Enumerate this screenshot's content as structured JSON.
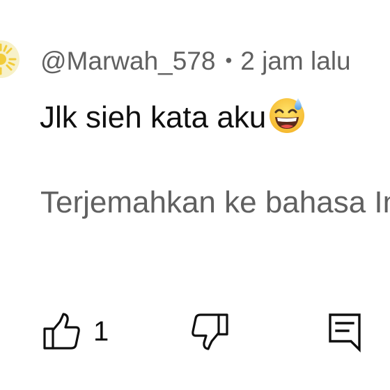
{
  "comment": {
    "author": "@Marwah_578",
    "separator": "•",
    "timestamp": "2 jam lalu",
    "text": "Jlk sieh kata aku",
    "emoji": "grinning-face-with-sweat-icon",
    "translate_label": "Terjemahkan ke bahasa Indonesia"
  },
  "actions": {
    "like_icon": "thumbs-up-icon",
    "like_count": "1",
    "dislike_icon": "thumbs-down-icon",
    "reply_icon": "reply-comment-icon"
  },
  "colors": {
    "primary_text": "#0f0f0f",
    "secondary_text": "#606060",
    "avatar_bg": "#f7f1c9",
    "avatar_accent": "#f2cc3a"
  }
}
